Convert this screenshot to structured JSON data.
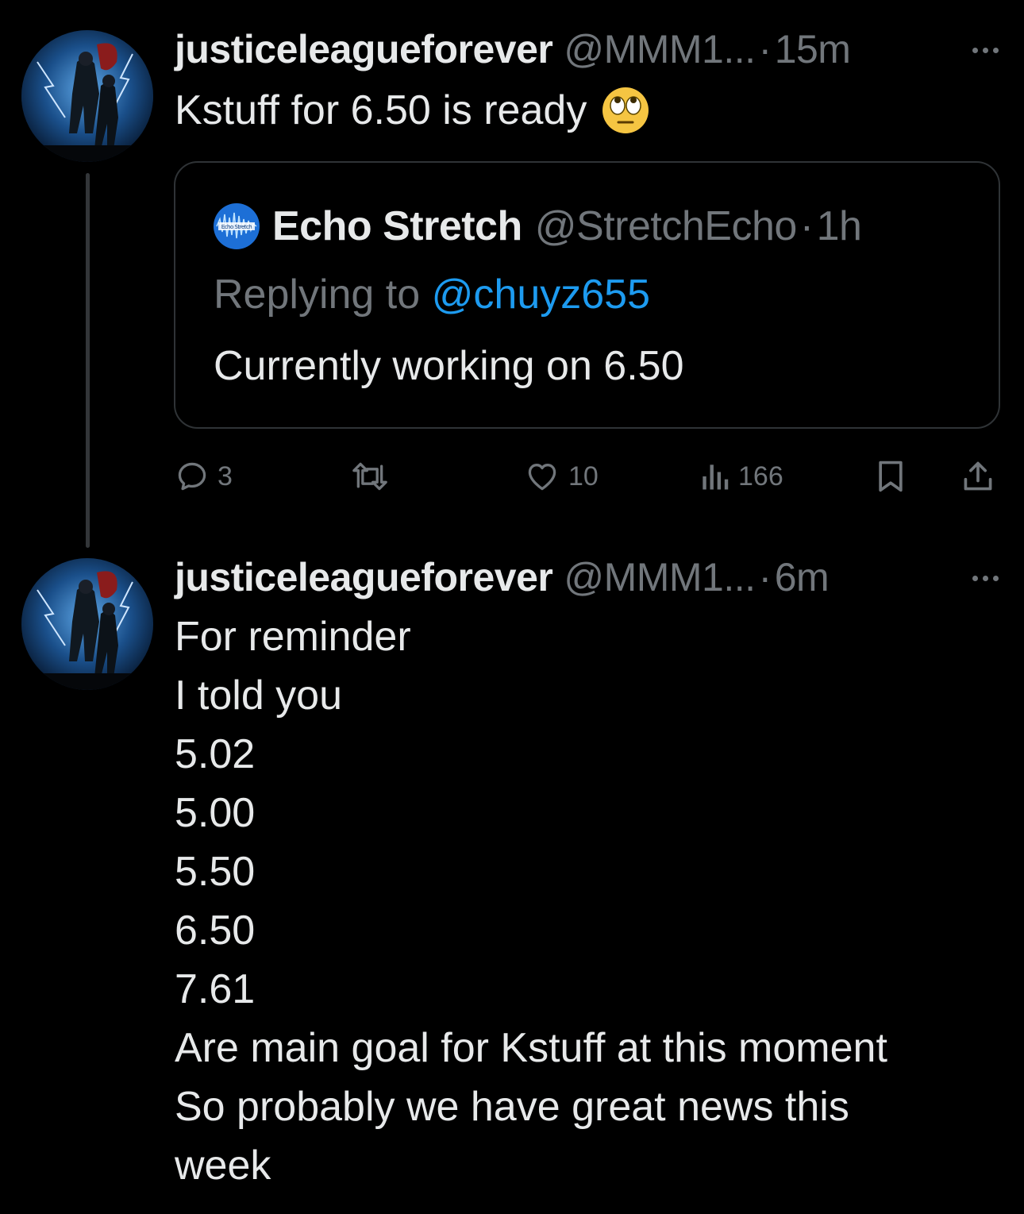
{
  "tweets": [
    {
      "display_name": "justiceleagueforever",
      "handle": "@MMM1...",
      "separator": "·",
      "time": "15m",
      "avatar_icon": "superhero-avatar",
      "text": "Kstuff for 6.50 is ready",
      "emoji": "face-with-rolling-eyes",
      "quote": {
        "avatar_icon": "echo-stretch-avatar",
        "avatar_caption": "Echo Stretch",
        "display_name": "Echo Stretch",
        "handle": "@StretchEcho",
        "separator": "·",
        "time": "1h",
        "replying_prefix": "Replying to ",
        "replying_mention": "@chuyz655",
        "text": "Currently working on 6.50"
      },
      "actions": {
        "reply_count": "3",
        "repost_count": "",
        "like_count": "10",
        "views_count": "166"
      }
    },
    {
      "display_name": "justiceleagueforever",
      "handle": "@MMM1...",
      "separator": "·",
      "time": "6m",
      "avatar_icon": "superhero-avatar",
      "lines": [
        "For reminder",
        "I told you",
        "5.02",
        "5.00",
        "5.50",
        "6.50",
        "7.61",
        "Are main goal for Kstuff at this moment",
        "So probably we have great news this",
        "week"
      ]
    }
  ],
  "colors": {
    "background": "#000000",
    "primary_text": "#e7e9ea",
    "secondary_text": "#71767b",
    "link": "#1d9bf0",
    "border": "#2f3336",
    "thread_line": "#333639"
  }
}
